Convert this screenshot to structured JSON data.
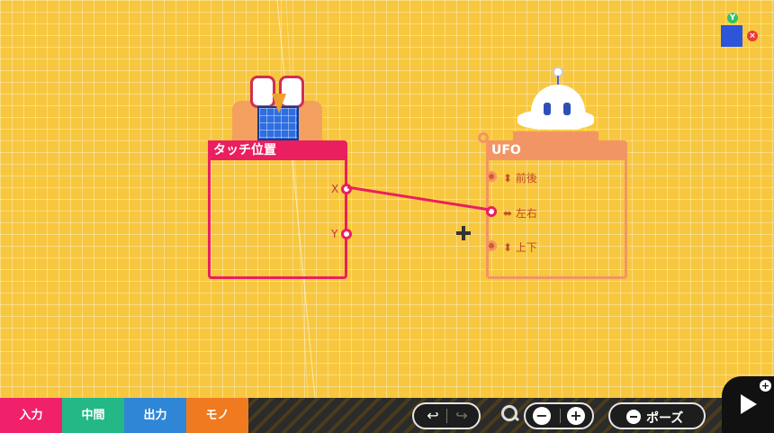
{
  "nodes": {
    "touch": {
      "title": "タッチ位置",
      "ports": [
        "X",
        "Y"
      ]
    },
    "ufo": {
      "title": "UFO",
      "ports": [
        "⬍ 前後",
        "⬌ 左右",
        "⬍ 上下"
      ]
    }
  },
  "categories": [
    {
      "label": "入力",
      "color": "#f0216a"
    },
    {
      "label": "中間",
      "color": "#23b886"
    },
    {
      "label": "出力",
      "color": "#2f86d6"
    },
    {
      "label": "モノ",
      "color": "#f07a20"
    }
  ],
  "toolbar": {
    "pause_label": "ポーズ",
    "zoom_minus": "−",
    "zoom_plus": "+"
  },
  "colors": {
    "background": "#f7c73f",
    "touch_node": "#ea1f5f",
    "ufo_node": "#f29565"
  },
  "icons": [
    "undo-icon",
    "redo-icon",
    "zoom-icon",
    "play-icon",
    "view-cube-icon",
    "crosshair-icon"
  ]
}
